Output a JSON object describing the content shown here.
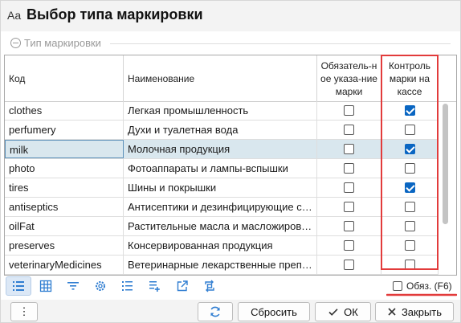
{
  "title": {
    "prefix": "Aa",
    "text": "Выбор типа маркировки"
  },
  "group": {
    "legend": "Тип маркировки"
  },
  "grid": {
    "columns": {
      "code": "Код",
      "name": "Наименование",
      "required": "Обязатель-ное указа-ние марки",
      "control": "Контроль марки на кассе"
    },
    "rows": [
      {
        "code": "clothes",
        "name": "Легкая промышленность",
        "required": false,
        "control": true
      },
      {
        "code": "perfumery",
        "name": "Духи и туалетная вода",
        "required": false,
        "control": false
      },
      {
        "code": "milk",
        "name": "Молочная продукция",
        "required": false,
        "control": true,
        "selected": true
      },
      {
        "code": "photo",
        "name": "Фотоаппараты и лампы-вспышки",
        "required": false,
        "control": false
      },
      {
        "code": "tires",
        "name": "Шины и покрышки",
        "required": false,
        "control": true
      },
      {
        "code": "antiseptics",
        "name": "Антисептики и дезинфицирующие с…",
        "required": false,
        "control": false
      },
      {
        "code": "oilFat",
        "name": "Растительные масла и масложирова…",
        "required": false,
        "control": false
      },
      {
        "code": "preserves",
        "name": "Консервированная продукция",
        "required": false,
        "control": false
      },
      {
        "code": "veterinaryMedicines",
        "name": "Ветеринарные лекарственные преп…",
        "required": false,
        "control": false
      }
    ]
  },
  "toolbar": {
    "icons": [
      "list-view-icon",
      "table-view-icon",
      "filter-icon",
      "settings-gear-icon",
      "numbered-list-icon",
      "add-rows-icon",
      "open-external-icon",
      "refresh-swap-icon"
    ]
  },
  "filter": {
    "label": "Обяз. (F6)",
    "checked": false
  },
  "buttons": {
    "more": "⋮",
    "reset": "Сбросить",
    "ok": "ОК",
    "close": "Закрыть"
  },
  "colors": {
    "highlight": "#e23b3b",
    "accent": "#0a66c2",
    "selected_row": "#d9e7ee"
  }
}
